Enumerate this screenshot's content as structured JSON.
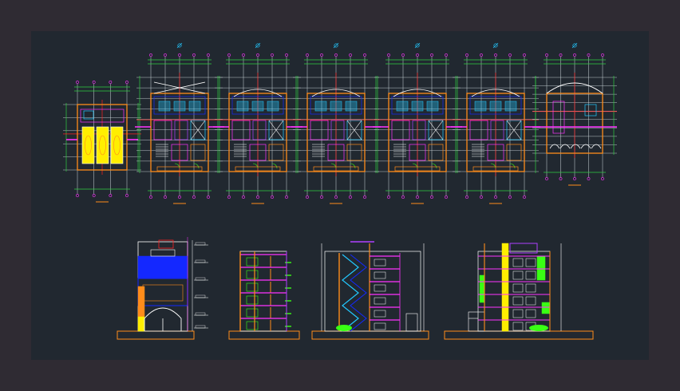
{
  "window": {
    "border_color": "#2f2b33",
    "canvas_color": "#212830"
  },
  "palette": {
    "grid": "#cfd8dc",
    "dim": "#2ecc40",
    "axis_red": "#ff2020",
    "wall": "#ff8c1a",
    "magenta": "#ff33ff",
    "cyan": "#22c8ff",
    "yellow": "#ffee00",
    "blue": "#1428ff",
    "white": "#ffffff",
    "green": "#39ff14",
    "purple": "#b040ff",
    "brown": "#8b4513"
  },
  "drawing": {
    "plans": [
      {
        "name": "plan-ground-floor"
      },
      {
        "name": "plan-floor-1"
      },
      {
        "name": "plan-floor-2"
      },
      {
        "name": "plan-floor-3"
      },
      {
        "name": "plan-floor-4"
      },
      {
        "name": "plan-floor-5"
      },
      {
        "name": "plan-roof"
      }
    ],
    "elevations": [
      {
        "name": "elevation-front"
      },
      {
        "name": "section-side"
      },
      {
        "name": "section-stair"
      },
      {
        "name": "elevation-lateral"
      }
    ]
  }
}
